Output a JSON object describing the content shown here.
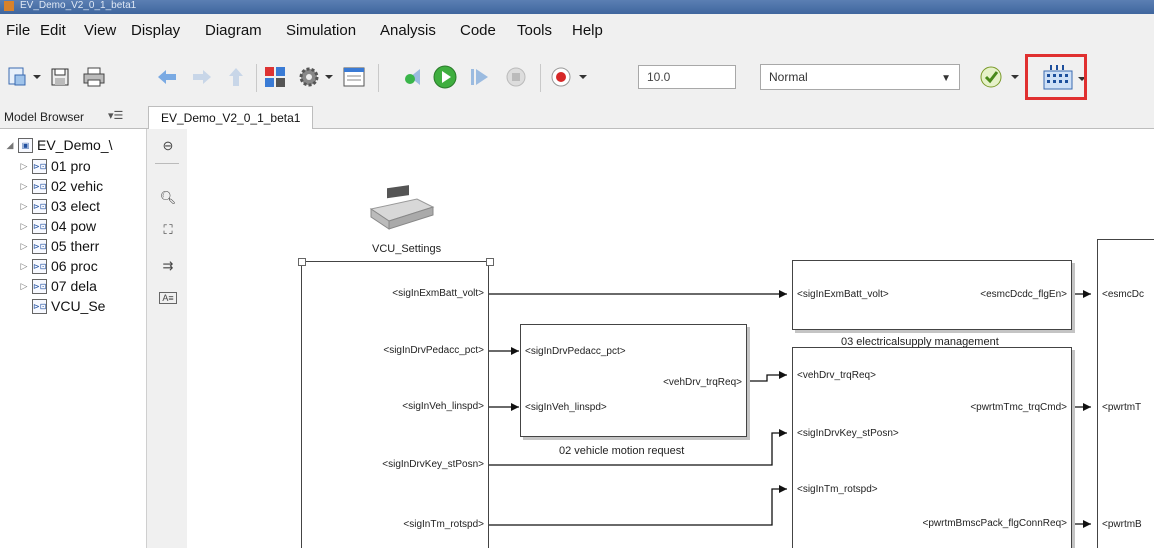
{
  "window": {
    "title": "EV_Demo_V2_0_1_beta1"
  },
  "menu": [
    "File",
    "Edit",
    "View",
    "Display",
    "Diagram",
    "Simulation",
    "Analysis",
    "Code",
    "Tools",
    "Help"
  ],
  "toolbar": {
    "stop_time": "10.0",
    "sim_mode": "Normal"
  },
  "tabs": {
    "model_browser": "Model Browser",
    "active_tab": "EV_Demo_V2_0_1_beta1"
  },
  "tree": {
    "root": "EV_Demo_\\",
    "items": [
      "01 pro",
      "02 vehic",
      "03 elect",
      "04 pow",
      "05 therr",
      "06 proc",
      "07 dela",
      "VCU_Se"
    ]
  },
  "diagram": {
    "settings_label": "VCU_Settings",
    "left_ports": [
      "<sigInExmBatt_volt>",
      "<sigInDrvPedacc_pct>",
      "<sigInVeh_linspd>",
      "<sigInDrvKey_stPosn>",
      "<sigInTm_rotspd>"
    ],
    "vmr": {
      "in1": "<sigInDrvPedacc_pct>",
      "in2": "<sigInVeh_linspd>",
      "out": "<vehDrv_trqReq>",
      "caption": "02 vehicle motion request"
    },
    "esm": {
      "in": "<sigInExmBatt_volt>",
      "out": "<esmcDcdc_flgEn>",
      "caption": "03 electricalsupply management"
    },
    "pwr": {
      "in1": "<vehDrv_trqReq>",
      "in2": "<sigInDrvKey_stPosn>",
      "in3": "<sigInTm_rotspd>",
      "out1": "<pwrtmTmc_trqCmd>",
      "out2": "<pwrtmBmscPack_flgConnReq>"
    },
    "right_ports": [
      "<esmcDc",
      "<pwrtmT",
      "<pwrtmB"
    ]
  }
}
